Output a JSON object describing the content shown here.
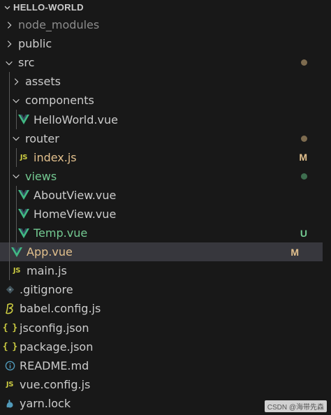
{
  "explorer": {
    "title": "HELLO-WORLD"
  },
  "colors": {
    "background": "#181818",
    "selected_row": "#37373d",
    "modified": "#e2c08d",
    "untracked": "#73c991",
    "vue_icon": "#41b883",
    "js_icon": "#cbcb41",
    "dot_brown": "#7d6b4f",
    "dot_green": "#3e6e4f"
  },
  "tree": [
    {
      "label": "node_modules",
      "type": "folder",
      "expanded": false,
      "depth": 0,
      "dimmed": true
    },
    {
      "label": "public",
      "type": "folder",
      "expanded": false,
      "depth": 0
    },
    {
      "label": "src",
      "type": "folder",
      "expanded": true,
      "depth": 0,
      "decoration": "dot-modified"
    },
    {
      "label": "assets",
      "type": "folder",
      "expanded": false,
      "depth": 1
    },
    {
      "label": "components",
      "type": "folder",
      "expanded": true,
      "depth": 1
    },
    {
      "label": "HelloWorld.vue",
      "type": "file",
      "icon": "vue-icon",
      "depth": 2
    },
    {
      "label": "router",
      "type": "folder",
      "expanded": true,
      "depth": 1,
      "decoration": "dot-modified"
    },
    {
      "label": "index.js",
      "type": "file",
      "icon": "js-icon",
      "depth": 2,
      "status": "M"
    },
    {
      "label": "views",
      "type": "folder",
      "expanded": true,
      "depth": 1,
      "decoration": "dot-untracked"
    },
    {
      "label": "AboutView.vue",
      "type": "file",
      "icon": "vue-icon",
      "depth": 2
    },
    {
      "label": "HomeView.vue",
      "type": "file",
      "icon": "vue-icon",
      "depth": 2
    },
    {
      "label": "Temp.vue",
      "type": "file",
      "icon": "vue-icon",
      "depth": 2,
      "status": "U"
    },
    {
      "label": "App.vue",
      "type": "file",
      "icon": "vue-icon",
      "depth": 1,
      "status": "M",
      "selected": true
    },
    {
      "label": "main.js",
      "type": "file",
      "icon": "js-icon",
      "depth": 1
    },
    {
      "label": ".gitignore",
      "type": "file",
      "icon": "git-icon",
      "depth": 0
    },
    {
      "label": "babel.config.js",
      "type": "file",
      "icon": "babel-icon",
      "depth": 0
    },
    {
      "label": "jsconfig.json",
      "type": "file",
      "icon": "json-icon",
      "depth": 0
    },
    {
      "label": "package.json",
      "type": "file",
      "icon": "json-icon",
      "depth": 0
    },
    {
      "label": "README.md",
      "type": "file",
      "icon": "info-icon",
      "depth": 0
    },
    {
      "label": "vue.config.js",
      "type": "file",
      "icon": "js-icon",
      "depth": 0
    },
    {
      "label": "yarn.lock",
      "type": "file",
      "icon": "yarn-icon",
      "depth": 0
    }
  ],
  "icon_text": {
    "js": "JS",
    "json": "{ }"
  },
  "watermark": "CSDN @海带先森"
}
